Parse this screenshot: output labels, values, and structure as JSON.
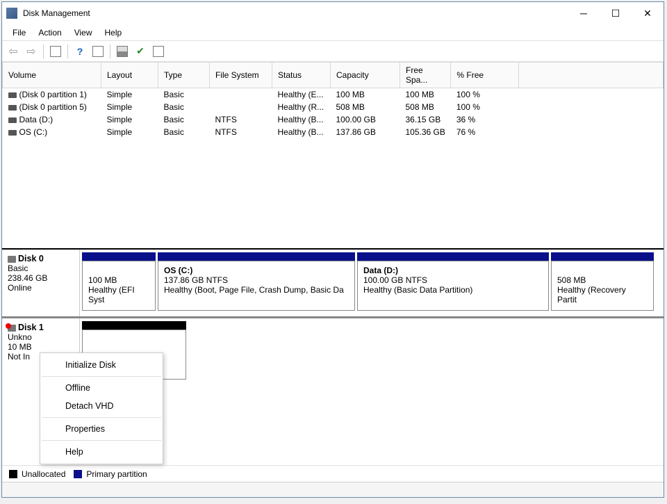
{
  "title": "Disk Management",
  "menu": {
    "file": "File",
    "action": "Action",
    "view": "View",
    "help": "Help"
  },
  "columns": {
    "volume": "Volume",
    "layout": "Layout",
    "type": "Type",
    "fs": "File System",
    "status": "Status",
    "capacity": "Capacity",
    "free": "Free Spa...",
    "pct": "% Free"
  },
  "rows": [
    {
      "volume": "(Disk 0 partition 1)",
      "layout": "Simple",
      "type": "Basic",
      "fs": "",
      "status": "Healthy (E...",
      "capacity": "100 MB",
      "free": "100 MB",
      "pct": "100 %"
    },
    {
      "volume": "(Disk 0 partition 5)",
      "layout": "Simple",
      "type": "Basic",
      "fs": "",
      "status": "Healthy (R...",
      "capacity": "508 MB",
      "free": "508 MB",
      "pct": "100 %"
    },
    {
      "volume": "Data (D:)",
      "layout": "Simple",
      "type": "Basic",
      "fs": "NTFS",
      "status": "Healthy (B...",
      "capacity": "100.00 GB",
      "free": "36.15 GB",
      "pct": "36 %"
    },
    {
      "volume": "OS (C:)",
      "layout": "Simple",
      "type": "Basic",
      "fs": "NTFS",
      "status": "Healthy (B...",
      "capacity": "137.86 GB",
      "free": "105.36 GB",
      "pct": "76 %"
    }
  ],
  "disk0": {
    "name": "Disk 0",
    "type": "Basic",
    "size": "238.46 GB",
    "state": "Online",
    "p1_line1": "100 MB",
    "p1_line2": "Healthy (EFI Syst",
    "p2_title": "OS  (C:)",
    "p2_sub": "137.86 GB NTFS",
    "p2_stat": "Healthy (Boot, Page File, Crash Dump, Basic Da",
    "p3_title": "Data  (D:)",
    "p3_sub": "100.00 GB NTFS",
    "p3_stat": "Healthy (Basic Data Partition)",
    "p4_line1": "508 MB",
    "p4_line2": "Healthy (Recovery Partit"
  },
  "disk1": {
    "name": "Disk 1",
    "type": "Unkno",
    "size": "10 MB",
    "state": "Not In"
  },
  "context": {
    "init": "Initialize Disk",
    "offline": "Offline",
    "detach": "Detach VHD",
    "props": "Properties",
    "help": "Help"
  },
  "legend": {
    "unalloc": "Unallocated",
    "primary": "Primary partition"
  }
}
